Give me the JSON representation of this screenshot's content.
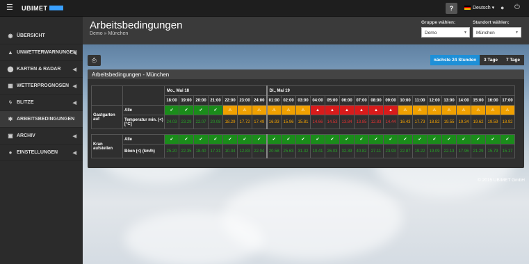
{
  "topbar": {
    "logo": "UBIMET",
    "help": "?",
    "language": "Deutsch"
  },
  "sidebar": {
    "items": [
      {
        "label": "ÜBERSICHT",
        "icon": "dashboard-icon",
        "caret": false,
        "active": false
      },
      {
        "label": "UNWETTERWARNUNGEN",
        "icon": "warning-icon",
        "caret": true,
        "active": false
      },
      {
        "label": "KARTEN & RADAR",
        "icon": "map-marker-icon",
        "caret": true,
        "active": false
      },
      {
        "label": "WETTERPROGNOSEN",
        "icon": "chart-icon",
        "caret": true,
        "active": false
      },
      {
        "label": "BLITZE",
        "icon": "lightning-icon",
        "caret": true,
        "active": false
      },
      {
        "label": "ARBEITSBEDINGUNGEN",
        "icon": "cogs-icon",
        "caret": false,
        "active": true
      },
      {
        "label": "ARCHIV",
        "icon": "archive-icon",
        "caret": true,
        "active": false
      },
      {
        "label": "EINSTELLUNGEN",
        "icon": "users-icon",
        "caret": true,
        "active": false
      }
    ]
  },
  "header": {
    "title": "Arbeitsbedingungen",
    "breadcrumb": "Demo » München",
    "group_label": "Gruppe wählen:",
    "group_value": "Demo",
    "location_label": "Standort wählen:",
    "location_value": "München"
  },
  "toolbar": {
    "ranges": [
      "nächste 24 Stunden",
      "3 Tage",
      "7 Tage"
    ],
    "active_range": "nächste 24 Stunden"
  },
  "panel": {
    "title": "Arbeitsbedingungen - München",
    "days": [
      "Mo., Mai 18",
      "Di., Mai 19"
    ],
    "hours": [
      "18:00",
      "19:00",
      "20:00",
      "21:00",
      "22:00",
      "23:00",
      "24:00",
      "01:00",
      "02:00",
      "03:00",
      "04:00",
      "05:00",
      "06:00",
      "07:00",
      "08:00",
      "09:00",
      "10:00",
      "11:00",
      "12:00",
      "13:00",
      "14:00",
      "15:00",
      "16:00",
      "17:00"
    ],
    "groups": [
      {
        "name": "Gastgarten auf",
        "alle_label": "Alle",
        "param_label": "Temperatur min. (<) [°C]",
        "status": [
          "g",
          "g",
          "g",
          "g",
          "o",
          "o",
          "o",
          "o",
          "o",
          "o",
          "r",
          "r",
          "r",
          "r",
          "r",
          "r",
          "o",
          "o",
          "o",
          "o",
          "o",
          "o",
          "o",
          "o"
        ],
        "values": [
          "24.03",
          "23.29",
          "22.07",
          "20.08",
          "18.29",
          "17.72",
          "17.49",
          "16.93",
          "15.96",
          "15.81",
          "14.66",
          "14.53",
          "13.84",
          "13.85",
          "12.83",
          "14.44",
          "16.43",
          "17.73",
          "18.82",
          "19.55",
          "19.34",
          "19.62",
          "19.59",
          "18.92"
        ]
      },
      {
        "name": "Kran aufstellen",
        "alle_label": "Alle",
        "param_label": "Böen (<) (km/h)",
        "status": [
          "g",
          "g",
          "g",
          "g",
          "g",
          "g",
          "g",
          "g",
          "g",
          "g",
          "g",
          "g",
          "g",
          "g",
          "g",
          "g",
          "g",
          "g",
          "g",
          "g",
          "g",
          "g",
          "g",
          "g"
        ],
        "values": [
          "25.20",
          "22.35",
          "18.40",
          "17.31",
          "10.34",
          "12.83",
          "22.04",
          "20.58",
          "25.63",
          "31.32",
          "10.41",
          "26.03",
          "32.39",
          "40.82",
          "27.11",
          "23.93",
          "22.87",
          "19.22",
          "19.09",
          "22.13",
          "17.96",
          "21.29",
          "15.79",
          "15.17"
        ]
      }
    ]
  },
  "footer": "© 2015 UBIMET GmbH",
  "colors": {
    "ok": "#1a8c1a",
    "warn": "#f0a000",
    "bad": "#d81b1b",
    "accent": "#1e90d8"
  }
}
